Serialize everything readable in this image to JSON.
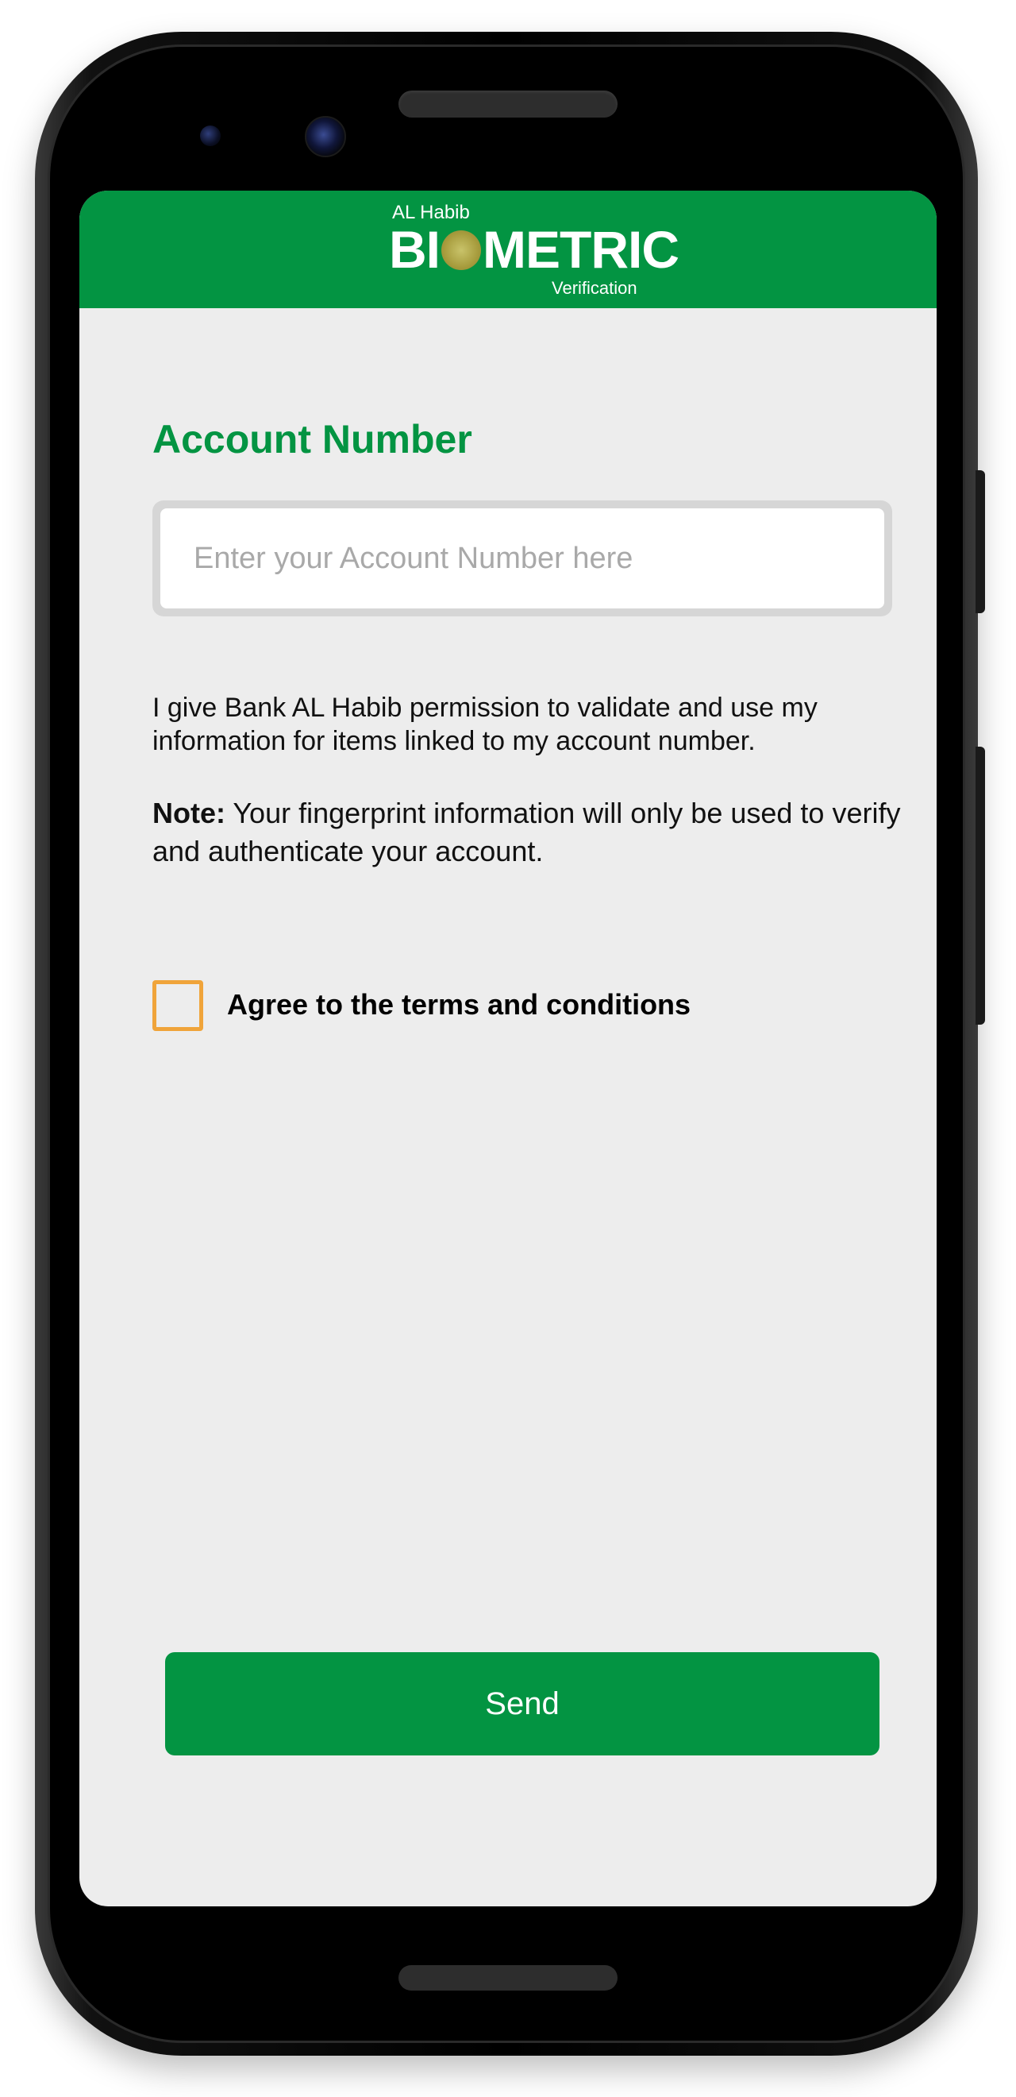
{
  "app": {
    "logo": {
      "top_text": "AL Habib",
      "main_text_before": "BI",
      "main_text_after": "METRIC",
      "sub_text": "Verification"
    }
  },
  "form": {
    "title": "Account Number",
    "account_input": {
      "value": "",
      "placeholder": "Enter your Account Number here"
    },
    "permission_text": "I give Bank AL Habib permission to validate and use my information for items linked to my account number.",
    "note_label": "Note:",
    "note_text": " Your fingerprint information will only be used to verify and authenticate your account.",
    "terms_checkbox": {
      "checked": false,
      "label": "Agree to the terms and conditions"
    },
    "send_label": "Send"
  },
  "colors": {
    "brand_green": "#039442",
    "checkbox_orange": "#f0a43a",
    "screen_background": "#ededed"
  },
  "icons": {
    "logo_o": "fingerprint-icon"
  }
}
